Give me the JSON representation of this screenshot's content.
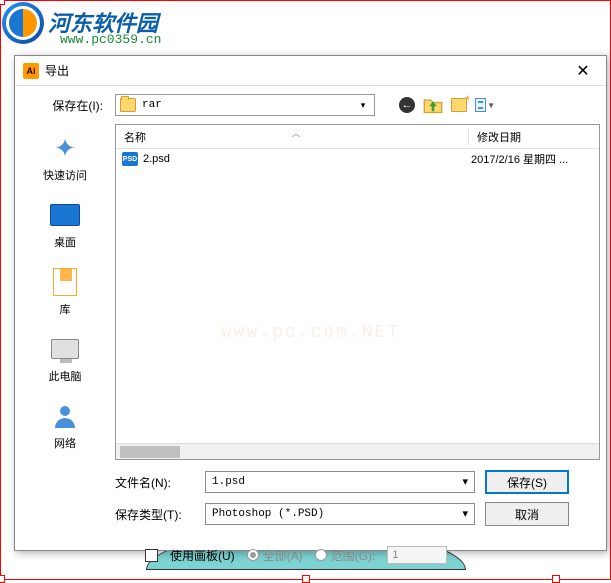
{
  "watermark": {
    "brand": "河东软件园",
    "url": "www.pc0359.cn",
    "center": "www.pc.com.NET"
  },
  "dialog": {
    "title": "导出",
    "close_label": "✕"
  },
  "toolbar": {
    "save_in_label": "保存在(I):",
    "location": "rar",
    "dropdown_arrow": "▾"
  },
  "sidebar": {
    "quick_access": "快速访问",
    "desktop": "桌面",
    "library": "库",
    "this_pc": "此电脑",
    "network": "网络"
  },
  "filelist": {
    "col_name": "名称",
    "col_date": "修改日期",
    "sort_caret": "︿",
    "files": [
      {
        "icon": "PSD",
        "name": "2.psd",
        "date": "2017/2/16 星期四 ..."
      }
    ]
  },
  "fields": {
    "filename_label": "文件名(N):",
    "filename_value": "1.psd",
    "filetype_label": "保存类型(T):",
    "filetype_value": "Photoshop (*.PSD)",
    "dropdown_arrow": "▾"
  },
  "buttons": {
    "save": "保存(S)",
    "cancel": "取消"
  },
  "options": {
    "use_artboard": "使用画板(U)",
    "all": "全部(A)",
    "range": "范围(G):",
    "range_value": "1"
  }
}
